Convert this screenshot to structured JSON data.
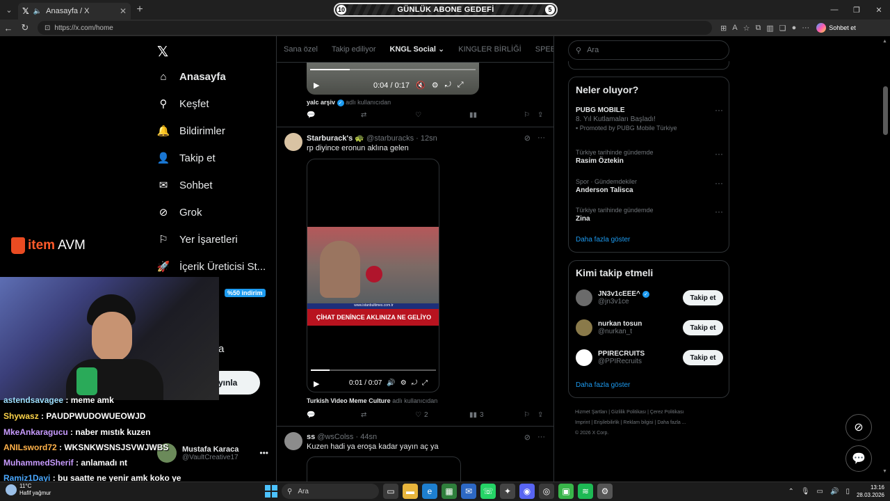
{
  "browser": {
    "tab_title": "Anasayfa / X",
    "url": "https://x.com/home",
    "sohbet_label": "Sohbet et"
  },
  "stream": {
    "goal_left": "10",
    "goal_label": "GÜNLÜK ABONE GEDEFİ",
    "goal_right": "5",
    "sponsor_item": "item",
    "sponsor_avm": "AVM",
    "chat": [
      {
        "user": "astendsavagee",
        "msg": " : meme amk",
        "color": "#9fe0ff"
      },
      {
        "user": "Shywasz",
        "msg": " : PAUDPWUDOWUEOWJD",
        "color": "#ffd54a"
      },
      {
        "user": "MkeAnkaragucu",
        "msg": " : naber mıstık kuzen",
        "color": "#c89bff"
      },
      {
        "user": "ANILsword72",
        "msg": " : WKSNKWSNSJSVWJWBS",
        "color": "#ffb24a"
      },
      {
        "user": "MuhammedSherif",
        "msg": " : anlamadı nt",
        "color": "#c89bff"
      },
      {
        "user": "Ramiz1Dayi",
        "msg": " : bu saatte ne yenir amk koko ye",
        "color": "#4aa8ff"
      }
    ]
  },
  "nav": {
    "items": [
      {
        "label": "Anasayfa",
        "icon": "home-icon"
      },
      {
        "label": "Keşfet",
        "icon": "search-icon"
      },
      {
        "label": "Bildirimler",
        "icon": "bell-icon"
      },
      {
        "label": "Takip et",
        "icon": "add-user-icon"
      },
      {
        "label": "Sohbet",
        "icon": "mail-icon"
      },
      {
        "label": "Grok",
        "icon": "grok-icon"
      },
      {
        "label": "Yer İşaretleri",
        "icon": "bookmark-icon"
      },
      {
        "label": "İçerik Üreticisi St...",
        "icon": "rocket-icon"
      }
    ],
    "discount_badge": "%50 indirim",
    "partial_item": "a",
    "post_button": "yınla",
    "account_name": "Mustafa Karaca",
    "account_handle": "@VaultCreative17"
  },
  "timeline": {
    "tabs": [
      "Sana özel",
      "Takip ediliyor",
      "KNGL Social",
      "KINGLER BİRLİĞİ",
      "SPEED G"
    ],
    "video1": {
      "time": "0:04 / 0:17",
      "progress": 0.24,
      "attrib_name": "yalc arşiv",
      "attrib_rest": "adlı kullanıcıdan"
    },
    "tweet1": {
      "name": "Starburack's",
      "meta": "@starburacks · 12sn",
      "text": "rp diyince eronun aklına gelen",
      "caption": "ÇİHAT DENİNCE AKLINIZA NE GELİYO",
      "strip": "www.istanbultimes.com.tr",
      "time": "0:01 / 0:07",
      "progress": 0.15,
      "attrib_name": "Turkish Video Meme Culture",
      "attrib_rest": "adlı kullanıcıdan",
      "likes": "2",
      "views": "3"
    },
    "tweet2": {
      "name": "ss",
      "meta": "@wsColss · 44sn",
      "text": "Kuzen hadi ya eroşa kadar yayın aç ya"
    }
  },
  "right": {
    "search_placeholder": "Ara",
    "trends_title": "Neler oluyor?",
    "trends": [
      {
        "cat": "",
        "name": "PUBG MOBILE",
        "sub": "8. Yıl Kutlamaları Başladı!",
        "promo": "Promoted by PUBG Mobile Türkiye"
      },
      {
        "cat": "Türkiye tarihinde gündemde",
        "name": "Rasim Öztekin",
        "sub": "",
        "promo": ""
      },
      {
        "cat": "Spor · Gündemdekiler",
        "name": "Anderson Talisca",
        "sub": "",
        "promo": ""
      },
      {
        "cat": "Türkiye tarihinde gündemde",
        "name": "Zina",
        "sub": "",
        "promo": ""
      }
    ],
    "show_more": "Daha fazla göster",
    "follow_title": "Kimi takip etmeli",
    "follow": [
      {
        "name": "JN3v1cEEE^",
        "handle": "@jn3v1ce",
        "verified": true,
        "color": "#6b6b6b"
      },
      {
        "name": "nurkan tosun",
        "handle": "@nurkan_t",
        "verified": false,
        "color": "#8a7a4a"
      },
      {
        "name": "PPIRECRUITS",
        "handle": "@PPIRecruits",
        "verified": false,
        "color": "#ffffff"
      }
    ],
    "follow_button": "Takip et",
    "footer": [
      "Hizmet Şartları",
      "Gizlilik Politikası",
      "Çerez Politikası",
      "Imprint",
      "Erişilebilirlik",
      "Reklam bilgisi",
      "Daha fazla ...",
      "© 2026 X Corp."
    ]
  },
  "taskbar": {
    "temp": "11°C",
    "weather": "Hafif yağmur",
    "search": "Ara",
    "time": "13:16",
    "date": "28.03.2026"
  }
}
